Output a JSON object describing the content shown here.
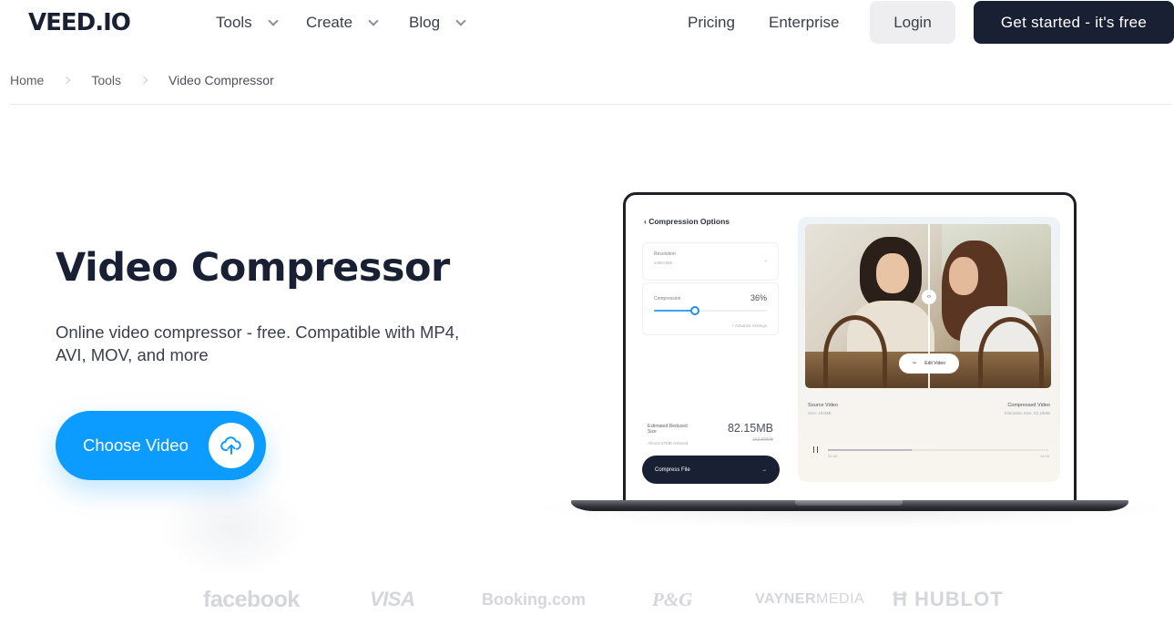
{
  "header": {
    "logo": "VEED.IO",
    "nav": [
      {
        "label": "Tools",
        "has_dropdown": true
      },
      {
        "label": "Create",
        "has_dropdown": true
      },
      {
        "label": "Blog",
        "has_dropdown": true
      }
    ],
    "links": [
      {
        "label": "Pricing"
      },
      {
        "label": "Enterprise"
      }
    ],
    "login_label": "Login",
    "cta_label": "Get started - it's free"
  },
  "breadcrumb": [
    {
      "label": "Home"
    },
    {
      "label": "Tools"
    },
    {
      "label": "Video Compressor"
    }
  ],
  "hero": {
    "title": "Video Compressor",
    "subtitle": "Online video compressor - free. Compatible with MP4, AVI, MOV, and more",
    "choose_button_label": "Choose Video",
    "choose_button_icon": "cloud-upload-icon"
  },
  "mockup": {
    "options_title": "Compression Options",
    "resolution_label": "Resolution",
    "resolution_value": "1080×960",
    "compression_label": "Compression",
    "compression_value": "36%",
    "compression_fraction": 0.36,
    "advance_settings": "+ Advance Settings",
    "estimated_label": "Estimated Reduced Size",
    "estimated_value": "82.15MB",
    "original_value": "152.80MB",
    "reduced_note": "Almost 87MB reduced",
    "compress_button": "Compress File",
    "compress_arrow": "→",
    "edit_video_label": "Edit Video",
    "edit_video_icon": "✂",
    "split_handle_glyph": "‹›",
    "source_title": "Source Video",
    "source_size": "Size: 152MB",
    "compressed_title": "Compressed Video",
    "compressed_size": "Estimates Size: 82.15MB",
    "playback_progress": 0.38,
    "time_current": "02:45",
    "time_total": "14:28"
  },
  "brands": {
    "facebook": "facebook",
    "visa": "VISA",
    "booking": "Booking.com",
    "pg": "P&G",
    "vayner_bold": "VAYNER",
    "vayner_light": "MEDIA",
    "hublot": "HUBLOT",
    "hublot_mark": "Ħ"
  },
  "colors": {
    "primary_dark": "#1a2033",
    "accent_blue": "#0c9bff",
    "login_bg": "#eeeef1",
    "brand_gray": "#d4d6db"
  }
}
